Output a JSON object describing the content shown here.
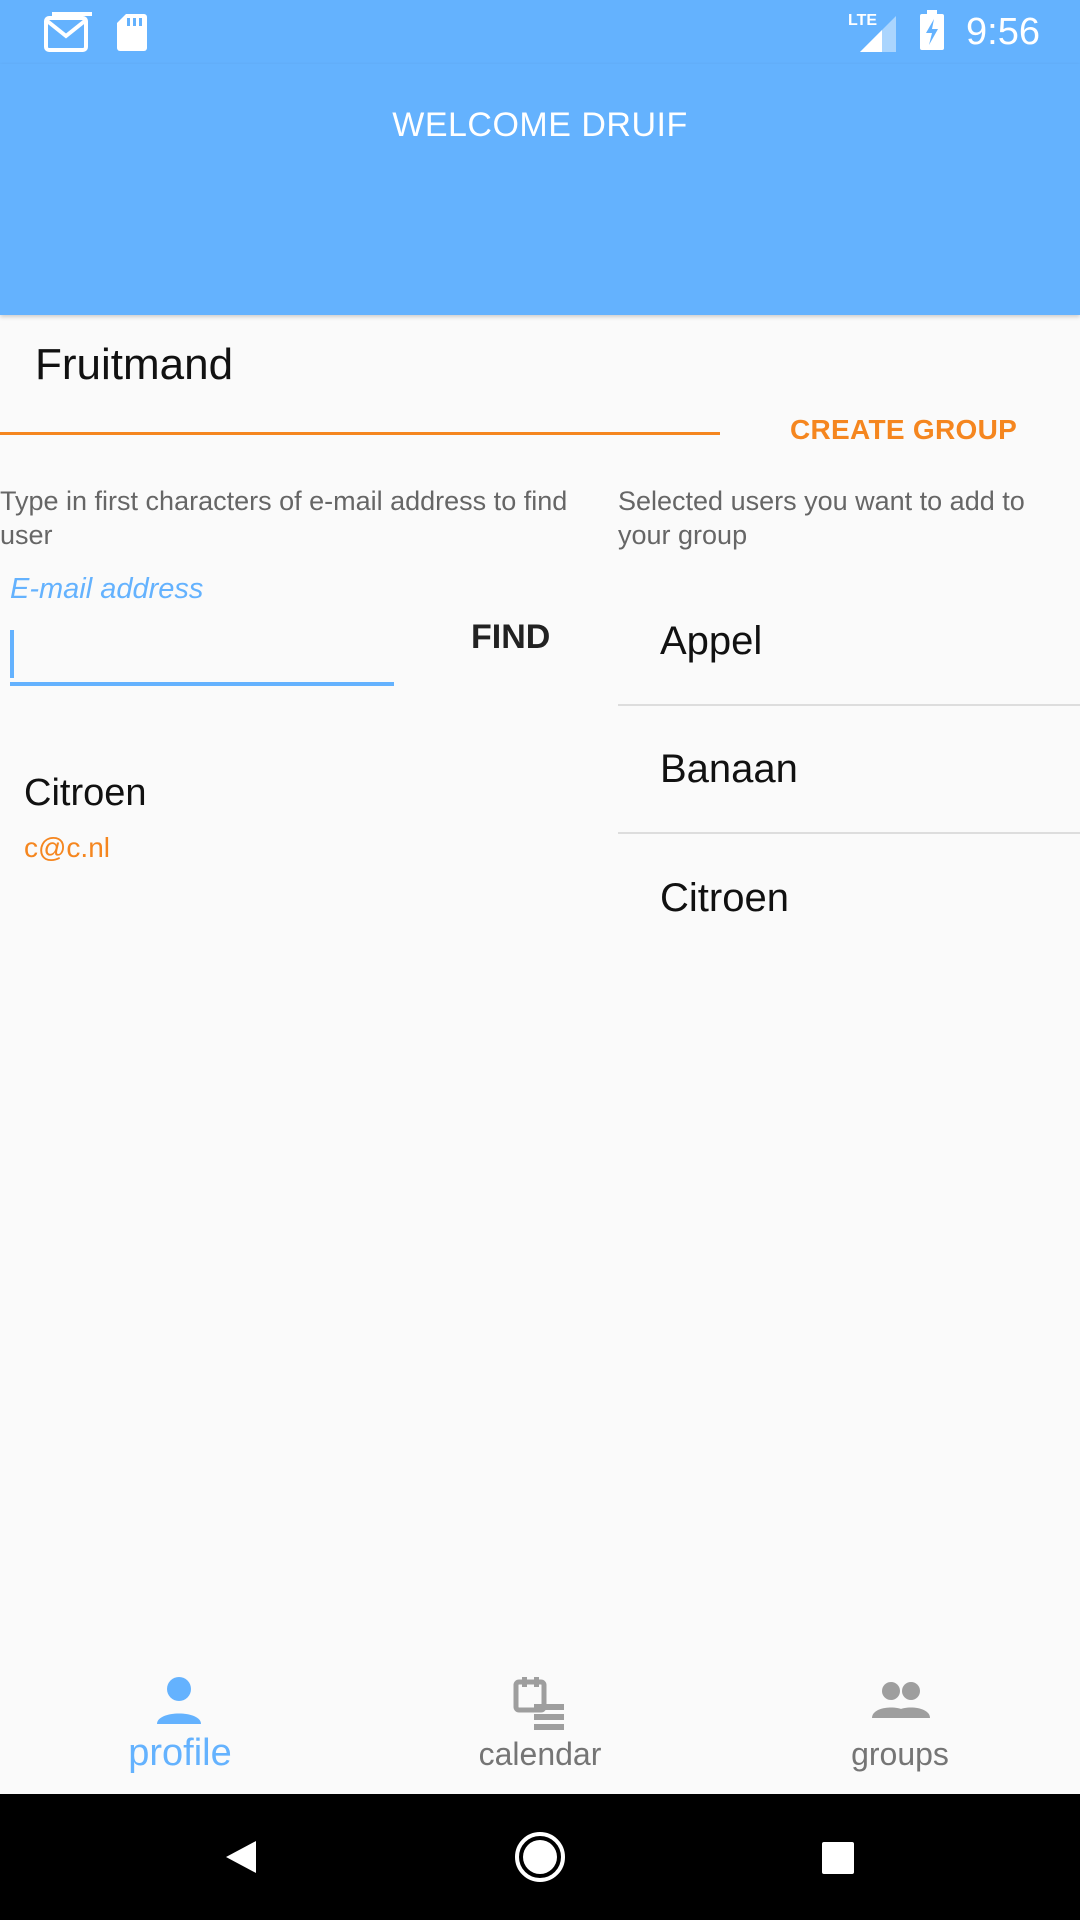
{
  "status_bar": {
    "time": "9:56",
    "network": "LTE",
    "left_icons": [
      "gmail-icon",
      "sd-card-icon"
    ],
    "right_icons": [
      "signal-icon",
      "battery-charging-icon"
    ]
  },
  "header": {
    "title": "WELCOME DRUIF"
  },
  "group_form": {
    "group_name": "Fruitmand",
    "create_group_label": "CREATE GROUP",
    "find_hint": "Type in first characters of e-mail address to find user",
    "selected_hint": "Selected users you want to add to your group",
    "email_placeholder": "E-mail address",
    "email_value": "",
    "find_label": "FIND"
  },
  "search_results": [
    {
      "name": "Citroen",
      "email": "c@c.nl"
    }
  ],
  "selected_users": [
    {
      "name": "Appel"
    },
    {
      "name": "Banaan"
    },
    {
      "name": "Citroen"
    }
  ],
  "bottom_nav": {
    "items": [
      {
        "label": "profile",
        "icon": "person-icon",
        "active": true
      },
      {
        "label": "calendar",
        "icon": "calendar-list-icon",
        "active": false
      },
      {
        "label": "groups",
        "icon": "groups-icon",
        "active": false
      }
    ]
  },
  "colors": {
    "primary": "#64b2fe",
    "accent": "#f5861f",
    "inactive": "#9e9e9e"
  }
}
